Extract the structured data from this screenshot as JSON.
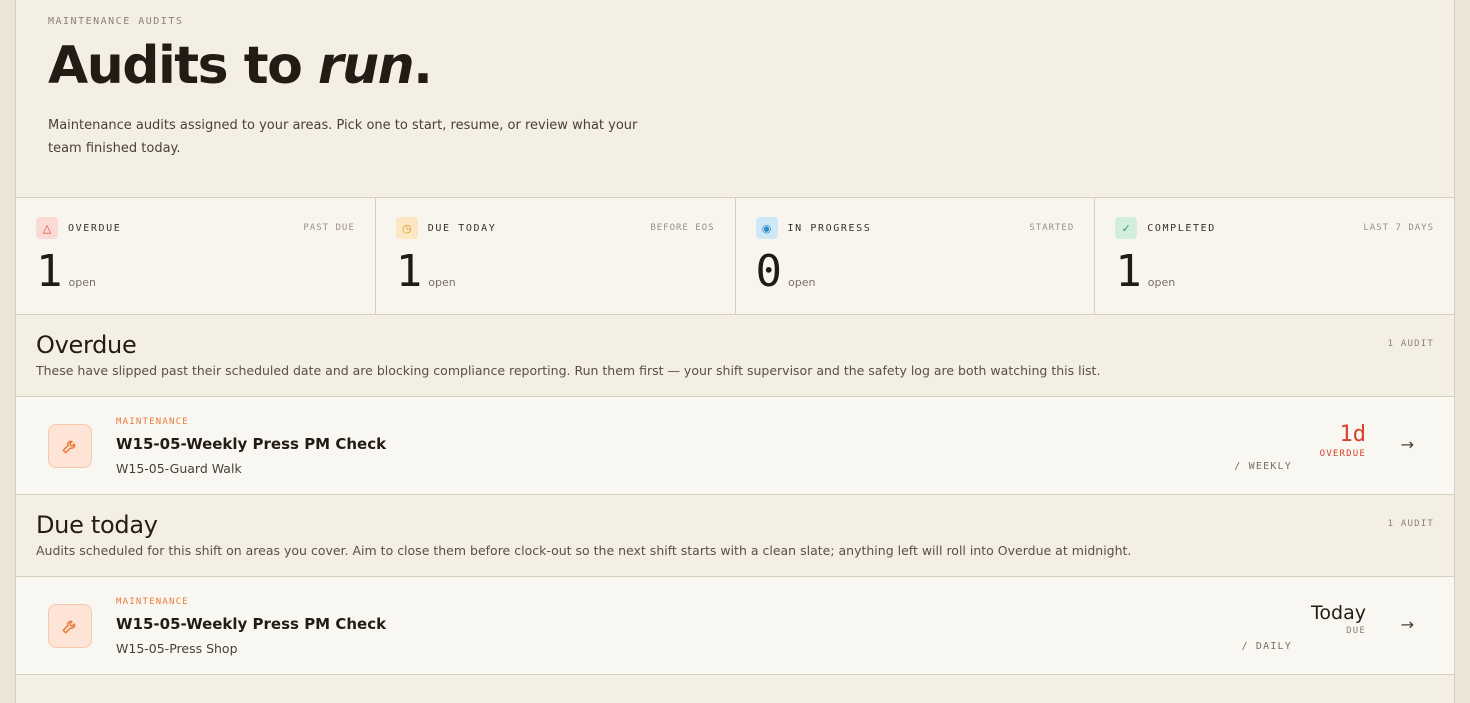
{
  "hero": {
    "eyebrow": "MAINTENANCE AUDITS",
    "title_main": "Audits to ",
    "title_em": "run",
    "title_end": ".",
    "subtitle": "Maintenance audits assigned to your areas. Pick one to start, resume, or review what your team finished today."
  },
  "stats": [
    {
      "label": "OVERDUE",
      "sub": "PAST DUE",
      "value": "1",
      "unit": "open",
      "icon": "warning-icon",
      "glyph": "△",
      "bg": "#fbd9d4",
      "fg": "#d9412c"
    },
    {
      "label": "DUE TODAY",
      "sub": "BEFORE EOS",
      "value": "1",
      "unit": "open",
      "icon": "clock-icon",
      "glyph": "◷",
      "bg": "#fde6c4",
      "fg": "#d89420"
    },
    {
      "label": "IN PROGRESS",
      "sub": "STARTED",
      "value": "0",
      "unit": "open",
      "icon": "progress-icon",
      "glyph": "◉",
      "bg": "#cfe8f6",
      "fg": "#2d8cc4"
    },
    {
      "label": "COMPLETED",
      "sub": "LAST 7 DAYS",
      "value": "1",
      "unit": "open",
      "icon": "check-icon",
      "glyph": "✓",
      "bg": "#d4eede",
      "fg": "#2e9a5a"
    }
  ],
  "sections": {
    "overdue": {
      "title": "Overdue",
      "count": "1 AUDIT",
      "desc": "These have slipped past their scheduled date and are blocking compliance reporting. Run them first — your shift supervisor and the safety log are both watching this list.",
      "row": {
        "kind": "MAINTENANCE",
        "title": "W15-05-Weekly Press PM Check",
        "area": "W15-05-Guard Walk",
        "freq": "/ WEEKLY",
        "due_val": "1d",
        "due_lbl": "OVERDUE"
      }
    },
    "today": {
      "title": "Due today",
      "count": "1 AUDIT",
      "desc": "Audits scheduled for this shift on areas you cover. Aim to close them before clock-out so the next shift starts with a clean slate; anything left will roll into Overdue at midnight.",
      "row": {
        "kind": "MAINTENANCE",
        "title": "W15-05-Weekly Press PM Check",
        "area": "W15-05-Press Shop",
        "freq": "/ DAILY",
        "due_val": "Today",
        "due_lbl": "DUE"
      }
    }
  },
  "icons": {
    "row_icon": "wrench-icon",
    "arrow": "arrow-right-icon"
  }
}
